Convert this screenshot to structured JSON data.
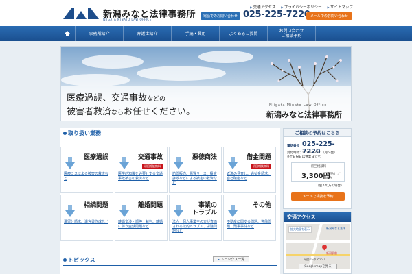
{
  "header": {
    "site_name": "新潟みなと法律事務所",
    "site_name_en": "NIIGATA MINATO LAW OFFICE",
    "top_links": [
      "交通アクセス",
      "プライバシーポリシー",
      "サイトマップ"
    ],
    "tel_label": "電話でのお問い合わせ",
    "tel_number": "025-225-7220",
    "mail_label": "メールでのお問い合わせ",
    "colors": {
      "brand": "#1e4e8c",
      "accent": "#e8731a"
    }
  },
  "nav": {
    "home_icon": "home-icon",
    "items": [
      "事務所紹介",
      "弁護士紹介",
      "手続・費用",
      "よくあるご質問",
      "お問い合わせ"
    ],
    "last_sub": "ご相談予約"
  },
  "hero": {
    "line1_a": "医療過誤、交通事故",
    "line1_b": "などの",
    "line2_a": "被害者救済",
    "line2_b": "なら",
    "line2_c": "お任せください。",
    "office_en": "Niigata Minato Law Office",
    "office_name": "新潟みなと法律事務所"
  },
  "practice": {
    "title": "取り扱い業務",
    "items": [
      {
        "title": "医療過誤",
        "badge": "",
        "desc": "医療ミスによる被害の救済など"
      },
      {
        "title": "交通事故",
        "badge": "初回相談無料",
        "desc": "医学的知識を必要とする交通事故被害の救済など"
      },
      {
        "title": "悪徳商法",
        "badge": "",
        "desc": "訪問販売、悪質リース、投資詐欺などによる被害の救済など"
      },
      {
        "title": "借金問題",
        "badge": "初回相談無料",
        "desc": "返済の見直し、過払金請求、自己破産など"
      },
      {
        "title": "相続問題",
        "badge": "",
        "desc": "遺留分請求、遺言書作成など"
      },
      {
        "title": "離婚問題",
        "badge": "",
        "desc": "離婚交渉・調停・裁判、離婚に伴う金銭問題など"
      },
      {
        "title": "事業の\nトラブル",
        "badge": "",
        "desc": "法人・個人事業主の方が直面される法的トラブル、労務問題など"
      },
      {
        "title": "その他",
        "badge": "",
        "desc": "不動産に関する問題、労働問題、刑事事件など"
      }
    ]
  },
  "contact": {
    "title": "ご相談の予約はこちら",
    "tel_label": "電話番号",
    "tel": "025-225-7220",
    "hours": "受付時間：9:00～17:00（月～金）",
    "closed": "※土日祝日は休業日です。",
    "fee_label": "初回相談料",
    "fee_price": "3,300円",
    "fee_unit": "（税込）／30分",
    "fee_note": "（個人の方の場合）",
    "mail_button": "メールで相談を予約"
  },
  "access": {
    "title": "交通アクセス",
    "map_enlarge": "拡大地図を表示",
    "map_label1": "新潟みなと法律",
    "map_label2": "新潟駅前",
    "map_data": "地図データ ©2015",
    "map_button": "［Googlemapを見る］"
  },
  "topics": {
    "title": "トピックス",
    "list_button": "トピックス一覧"
  }
}
